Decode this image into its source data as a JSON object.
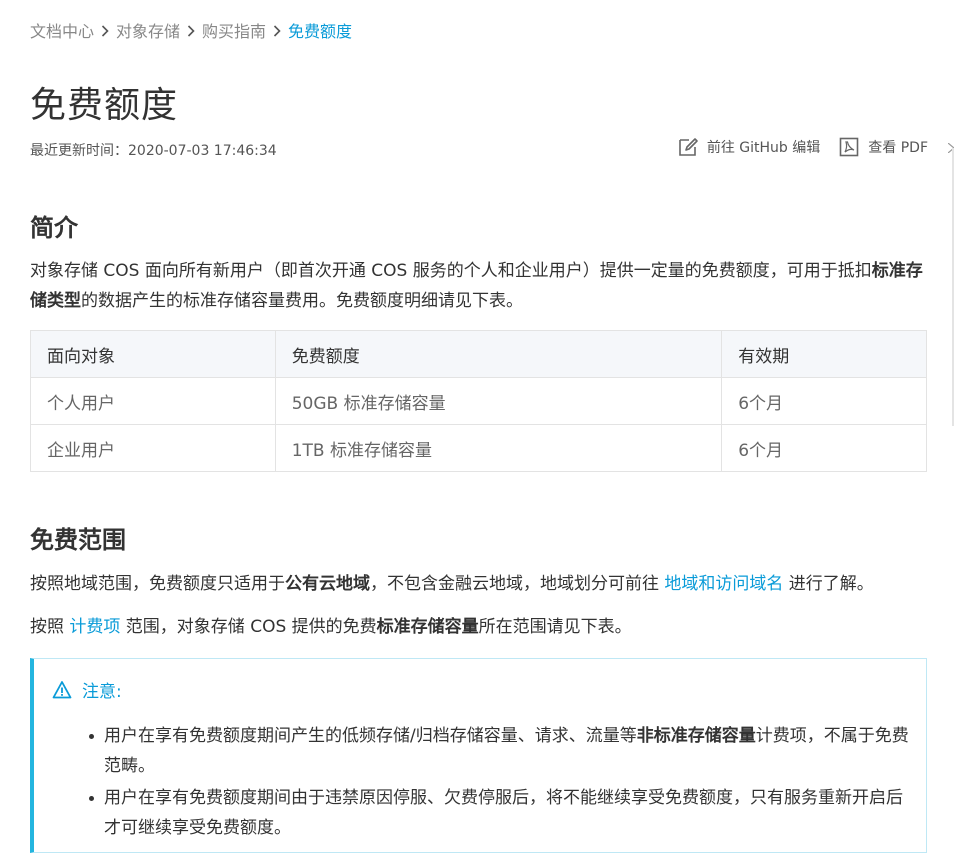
{
  "breadcrumb": {
    "items": [
      "文档中心",
      "对象存储",
      "购买指南"
    ],
    "current": "免费额度"
  },
  "page": {
    "title": "免费额度",
    "updated_label": "最近更新时间：",
    "updated_value": "2020-07-03 17:46:34"
  },
  "actions": {
    "github": "前往 GitHub 编辑",
    "pdf": "查看 PDF"
  },
  "intro": {
    "heading": "简介",
    "text_1": "对象存储 COS 面向所有新用户（即首次开通 COS 服务的个人和企业用户）提供一定量的免费额度，可用于抵扣",
    "bold_1": "标准存储类型",
    "text_2": "的数据产生的标准存储容量费用。免费额度明细请见下表。"
  },
  "table": {
    "headers": [
      "面向对象",
      "免费额度",
      "有效期"
    ],
    "rows": [
      [
        "个人用户",
        "50GB 标准存储容量",
        "6个月"
      ],
      [
        "企业用户",
        "1TB 标准存储容量",
        "6个月"
      ]
    ]
  },
  "scope": {
    "heading": "免费范围",
    "p1_text_1": "按照地域范围，免费额度只适用于",
    "p1_bold": "公有云地域",
    "p1_text_2": "，不包含金融云地域，地域划分可前往 ",
    "p1_link": "地域和访问域名",
    "p1_text_3": " 进行了解。",
    "p2_text_1": "按照 ",
    "p2_link": "计费项",
    "p2_text_2": " 范围，对象存储 COS 提供的免费",
    "p2_bold": "标准存储容量",
    "p2_text_3": "所在范围请见下表。"
  },
  "notice": {
    "title": "注意:",
    "item1_text_1": "用户在享有免费额度期间产生的低频存储/归档存储容量、请求、流量等",
    "item1_bold": "非标准存储容量",
    "item1_text_2": "计费项，不属于免费范畴。",
    "item2_text": "用户在享有免费额度期间由于违禁原因停服、欠费停服后，将不能继续享受免费额度，只有服务重新开启后才可继续享受免费额度。"
  },
  "colors": {
    "link": "#0a9bd8",
    "notice_border": "#24b5df",
    "table_header_bg": "#f5f7fa"
  },
  "icons": [
    "chevron-right-icon",
    "edit-icon",
    "pdf-icon",
    "warning-icon"
  ]
}
